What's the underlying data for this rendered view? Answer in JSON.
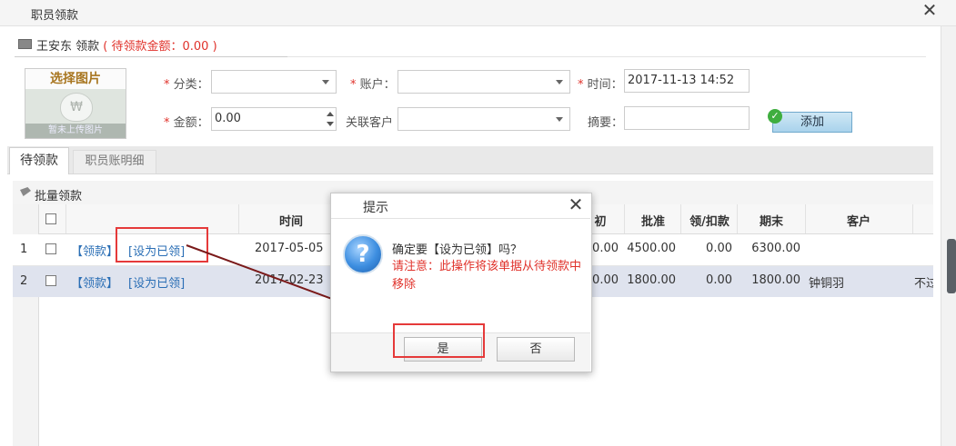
{
  "window": {
    "title": "职员领款",
    "close_glyph": "✕"
  },
  "header": {
    "employee": "王安东 领款",
    "pending_text": "( 待领款金额：0.00 )"
  },
  "image": {
    "title": "选择图片",
    "placeholder": "暂未上传图片",
    "icon": "money-bag-icon",
    "bag_glyph": "₩"
  },
  "form": {
    "category_label": "分类：",
    "account_label": "账户：",
    "time_label": "时间：",
    "time_value": "2017-11-13 14:52",
    "amount_label": "金额：",
    "amount_value": "0.00",
    "customer_label": "关联客户",
    "memo_label": "摘要：",
    "required_mark": "*",
    "add_button": "添加",
    "add_glyph": "✓"
  },
  "tabs": [
    {
      "label": "待领款",
      "active": true
    },
    {
      "label": "职员账明细",
      "active": false
    }
  ],
  "toolbar": {
    "batch_label": "批量领款"
  },
  "grid": {
    "columns": {
      "time": "时间",
      "initial_partial": "初",
      "approved": "批准",
      "collected_deducted": "领/扣款",
      "ending": "期末",
      "customer": "客户"
    },
    "rows": [
      {
        "no": "1",
        "action1": "【领款】",
        "action2": "[设为已领]",
        "time": "2017-05-05",
        "initial": "00.00",
        "approved": "4500.00",
        "collected": "0.00",
        "ending": "6300.00",
        "customer": "",
        "extra": ""
      },
      {
        "no": "2",
        "action1": "【领款】",
        "action2": "[设为已领]",
        "time": "2017-02-23",
        "initial": "0.00",
        "approved": "1800.00",
        "collected": "0.00",
        "ending": "1800.00",
        "customer": "钟铜羽",
        "extra": "不过"
      }
    ]
  },
  "dialog": {
    "title": "提示",
    "close_glyph": "✕",
    "message": "确定要【设为已领】吗？",
    "warning": "请注意：此操作将该单据从待领款中移除",
    "yes": "是",
    "no": "否",
    "question_glyph": "?"
  },
  "colors": {
    "annotation_red": "#e53a3a",
    "warning_red": "#e0322b",
    "link_blue": "#2a6eb5",
    "selected_row": "#dfe3ee"
  }
}
